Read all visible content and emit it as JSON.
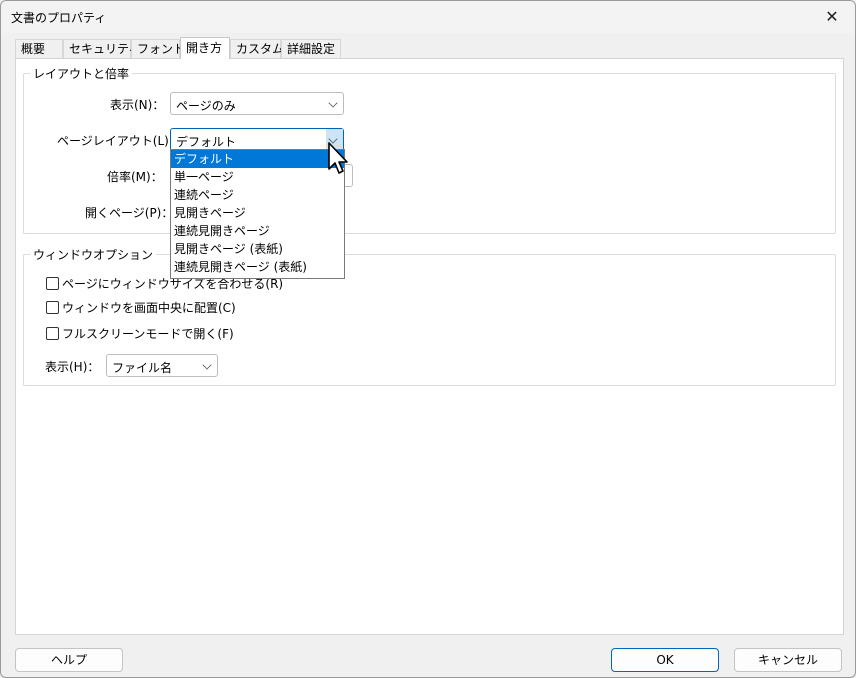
{
  "window": {
    "title": "文書のプロパティ",
    "close_glyph": "✕"
  },
  "tabs": [
    {
      "label": "概要"
    },
    {
      "label": "セキュリティ"
    },
    {
      "label": "フォント"
    },
    {
      "label": "開き方"
    },
    {
      "label": "カスタム"
    },
    {
      "label": "詳細設定"
    }
  ],
  "active_tab": "開き方",
  "layout_group": {
    "legend": "レイアウトと倍率",
    "display_label": "表示(N)：",
    "display_value": "ページのみ",
    "page_layout_label": "ページレイアウト(L)：",
    "page_layout_value": "デフォルト",
    "zoom_label": "倍率(M)：",
    "open_page_label": "開くページ(P)：",
    "page_layout_options": [
      "デフォルト",
      "単一ページ",
      "連続ページ",
      "見開きページ",
      "連続見開きページ",
      "見開きページ (表紙)",
      "連続見開きページ (表紙)"
    ],
    "page_layout_selected_index": 0
  },
  "window_group": {
    "legend": "ウィンドウオプション",
    "resize_to_page_label": "ページにウィンドウサイズを合わせる(R)",
    "center_window_label": "ウィンドウを画面中央に配置(C)",
    "fullscreen_label": "フルスクリーンモードで開く(F)",
    "show_label": "表示(H)：",
    "show_value": "ファイル名"
  },
  "buttons": {
    "help": "ヘルプ",
    "ok": "OK",
    "cancel": "キャンセル"
  }
}
